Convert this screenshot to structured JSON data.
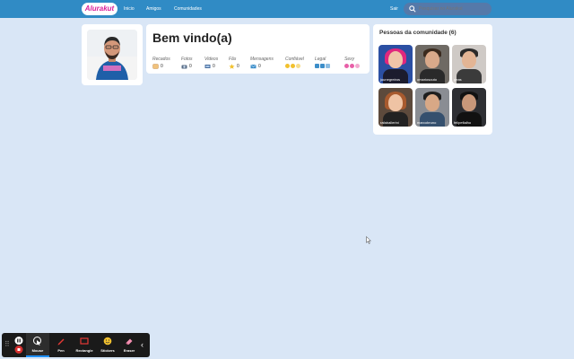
{
  "header": {
    "logo": "Alurakut",
    "nav": [
      "Inicio",
      "Amigos",
      "Comunidades"
    ],
    "logout": "Sair",
    "search_placeholder": "Pesquisar no Alurakut"
  },
  "welcome": {
    "title": "Bem vindo(a)",
    "stats": [
      {
        "label": "Recados",
        "value": "0",
        "icon": "message-icon"
      },
      {
        "label": "Fotos",
        "value": "0",
        "icon": "camera-icon"
      },
      {
        "label": "Videos",
        "value": "0",
        "icon": "video-icon"
      },
      {
        "label": "Fãs",
        "value": "0",
        "icon": "star-icon"
      },
      {
        "label": "Mensagens",
        "value": "0",
        "icon": "mail-icon"
      },
      {
        "label": "Confiável",
        "value": "",
        "icon": "smile-icon"
      },
      {
        "label": "Legal",
        "value": "",
        "icon": "cube-icon"
      },
      {
        "label": "Sexy",
        "value": "",
        "icon": "heart-icon"
      }
    ]
  },
  "community": {
    "title": "Pessoas da comunidade (6)",
    "members": [
      "juunegreiros",
      "omariosouto",
      "peas",
      "rafaballerini",
      "marcobruno",
      "felipefialho"
    ]
  },
  "toolbar": {
    "tools": [
      "Mouse",
      "Pen",
      "Rectangle",
      "Stickers",
      "Eraser"
    ]
  },
  "colors": {
    "topbar": "#308bc5",
    "brand": "#d81d99",
    "background": "#d9e6f6"
  }
}
